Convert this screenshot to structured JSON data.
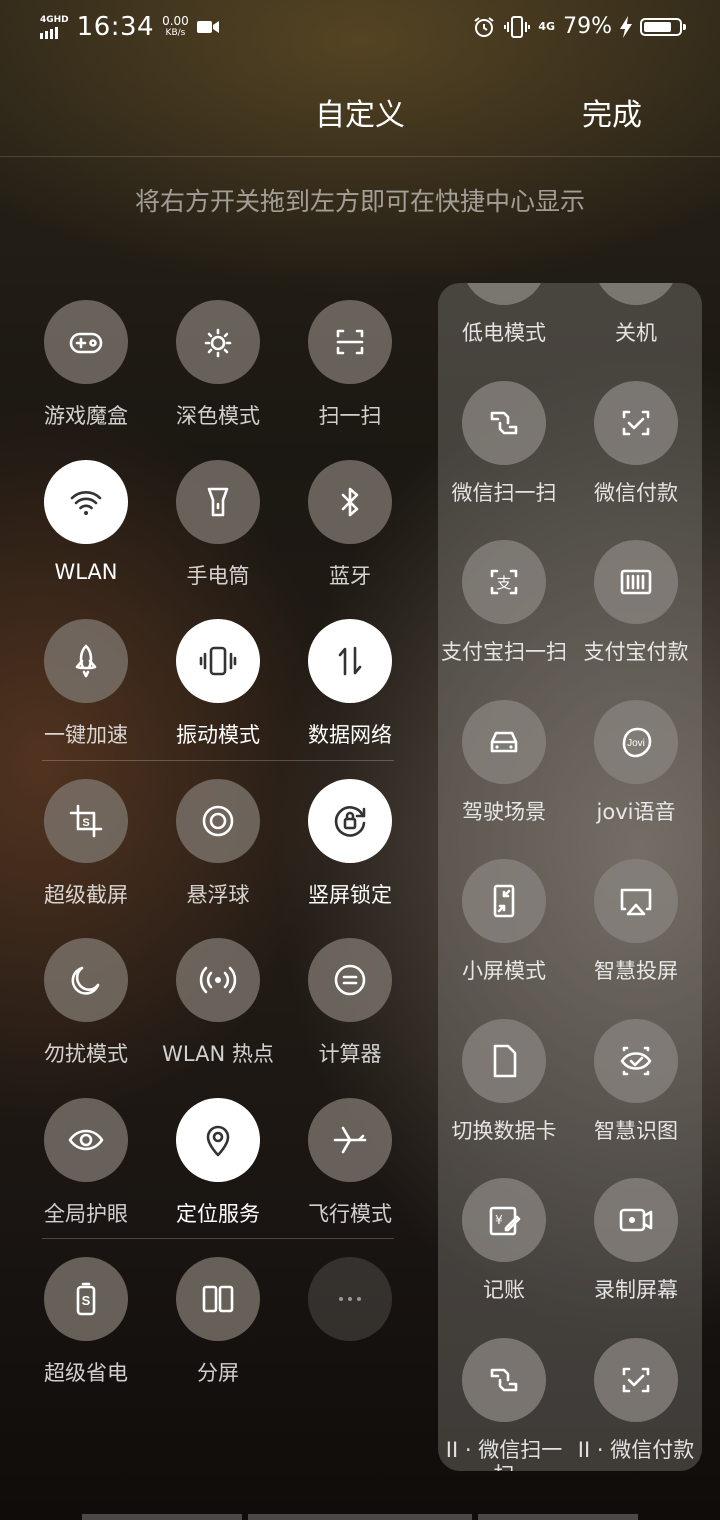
{
  "status_bar": {
    "network": "4GHD",
    "time": "16:34",
    "speed_value": "0.00",
    "speed_unit": "KB/s",
    "mobile_type": "4G",
    "battery": "79%",
    "battery_level": 0.79
  },
  "header": {
    "title": "自定义",
    "done": "完成"
  },
  "hint": "将右方开关拖到左方即可在快捷中心显示",
  "active_tiles": [
    {
      "label": "游戏魔盒",
      "icon": "gamepad-icon",
      "on": false
    },
    {
      "label": "深色模式",
      "icon": "dark-mode-icon",
      "on": false
    },
    {
      "label": "扫一扫",
      "icon": "scan-icon",
      "on": false
    },
    {
      "label": "WLAN",
      "icon": "wifi-icon",
      "on": true
    },
    {
      "label": "手电筒",
      "icon": "flashlight-icon",
      "on": false
    },
    {
      "label": "蓝牙",
      "icon": "bluetooth-icon",
      "on": false
    },
    {
      "label": "一键加速",
      "icon": "rocket-icon",
      "on": false
    },
    {
      "label": "振动模式",
      "icon": "vibrate-icon",
      "on": true
    },
    {
      "label": "数据网络",
      "icon": "data-arrows-icon",
      "on": true
    },
    {
      "label": "超级截屏",
      "icon": "crop-icon",
      "on": false
    },
    {
      "label": "悬浮球",
      "icon": "float-ball-icon",
      "on": false
    },
    {
      "label": "竖屏锁定",
      "icon": "rotation-lock-icon",
      "on": true
    },
    {
      "label": "勿扰模式",
      "icon": "moon-icon",
      "on": false
    },
    {
      "label": "WLAN 热点",
      "icon": "hotspot-icon",
      "on": false
    },
    {
      "label": "计算器",
      "icon": "calculator-icon",
      "on": false
    },
    {
      "label": "全局护眼",
      "icon": "eye-icon",
      "on": false
    },
    {
      "label": "定位服务",
      "icon": "location-icon",
      "on": true
    },
    {
      "label": "飞行模式",
      "icon": "airplane-icon",
      "on": false
    },
    {
      "label": "超级省电",
      "icon": "battery-saver-icon",
      "on": false
    },
    {
      "label": "分屏",
      "icon": "split-screen-icon",
      "on": false
    },
    {
      "label": "",
      "icon": "more-icon",
      "on": false
    }
  ],
  "available_tiles": [
    {
      "label": "低电模式",
      "icon": "low-power-icon"
    },
    {
      "label": "关机",
      "icon": "power-icon"
    },
    {
      "label": "微信扫一扫",
      "icon": "wechat-scan-icon"
    },
    {
      "label": "微信付款",
      "icon": "wechat-pay-icon"
    },
    {
      "label": "支付宝扫一扫",
      "icon": "alipay-scan-icon"
    },
    {
      "label": "支付宝付款",
      "icon": "alipay-pay-icon"
    },
    {
      "label": "驾驶场景",
      "icon": "car-icon"
    },
    {
      "label": "jovi语音",
      "icon": "jovi-icon"
    },
    {
      "label": "小屏模式",
      "icon": "small-screen-icon"
    },
    {
      "label": "智慧投屏",
      "icon": "cast-icon"
    },
    {
      "label": "切换数据卡",
      "icon": "sim-card-icon"
    },
    {
      "label": "智慧识图",
      "icon": "vision-icon"
    },
    {
      "label": "记账",
      "icon": "bookkeeping-icon"
    },
    {
      "label": "录制屏幕",
      "icon": "screen-record-icon"
    },
    {
      "label": "II · 微信扫一扫",
      "icon": "wechat-scan-icon"
    },
    {
      "label": "II · 微信付款",
      "icon": "wechat-pay-icon"
    }
  ],
  "jovi_text": "Jovi"
}
